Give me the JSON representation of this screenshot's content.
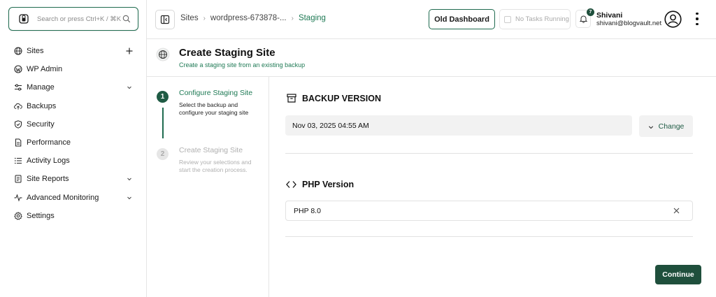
{
  "search": {
    "placeholder": "Search or press Ctrl+K / ⌘K"
  },
  "sidebar": {
    "items": [
      {
        "label": "Sites",
        "icon": "globe-icon",
        "trail": "plus-icon"
      },
      {
        "label": "WP Admin",
        "icon": "wordpress-icon",
        "trail": ""
      },
      {
        "label": "Manage",
        "icon": "sliders-icon",
        "trail": "chevron-down-icon"
      },
      {
        "label": "Backups",
        "icon": "cloud-upload-icon",
        "trail": ""
      },
      {
        "label": "Security",
        "icon": "shield-icon",
        "trail": ""
      },
      {
        "label": "Performance",
        "icon": "document-icon",
        "trail": ""
      },
      {
        "label": "Activity Logs",
        "icon": "list-icon",
        "trail": ""
      },
      {
        "label": "Site Reports",
        "icon": "report-icon",
        "trail": "chevron-down-icon"
      },
      {
        "label": "Advanced Monitoring",
        "icon": "pulse-icon",
        "trail": "chevron-down-icon"
      },
      {
        "label": "Settings",
        "icon": "gear-icon",
        "trail": ""
      }
    ]
  },
  "breadcrumb": {
    "items": [
      "Sites",
      "wordpress-673878-...",
      "Staging"
    ]
  },
  "header": {
    "old_dashboard_label": "Old Dashboard",
    "tasks_label": "No Tasks Running",
    "notification_count": "7",
    "user_name": "Shivani",
    "user_email": "shivani@blogvault.net"
  },
  "page": {
    "title": "Create Staging Site",
    "subtitle": "Create a staging site from an existing backup"
  },
  "steps": [
    {
      "number": "1",
      "title": "Configure Staging Site",
      "description": "Select the backup and configure your staging site",
      "state": "active"
    },
    {
      "number": "2",
      "title": "Create Staging Site",
      "description": "Review your selections and start the creation process.",
      "state": "inactive"
    }
  ],
  "backup": {
    "heading": "BACKUP VERSION",
    "value": "Nov 03, 2025 04:55 AM",
    "change_label": "Change"
  },
  "php": {
    "heading": "PHP Version",
    "value": "PHP 8.0"
  },
  "actions": {
    "continue_label": "Continue"
  },
  "colors": {
    "accent": "#1f7a55",
    "primary_dark": "#1f4f3c"
  }
}
